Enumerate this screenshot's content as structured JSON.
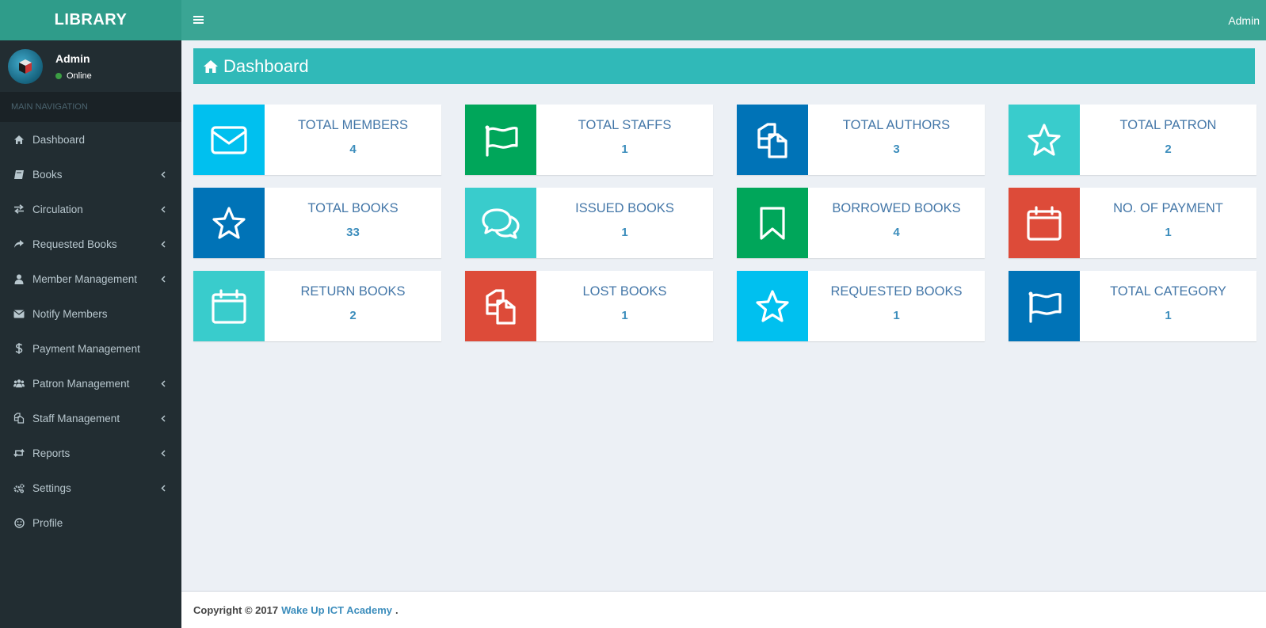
{
  "brand": "LIBRARY",
  "header": {
    "user_label": "Admin"
  },
  "user_panel": {
    "name": "Admin",
    "status": "Online"
  },
  "nav": {
    "header": "MAIN NAVIGATION",
    "items": [
      {
        "label": "Dashboard",
        "icon": "home-icon",
        "has_children": false
      },
      {
        "label": "Books",
        "icon": "book-icon",
        "has_children": true
      },
      {
        "label": "Circulation",
        "icon": "exchange-icon",
        "has_children": true
      },
      {
        "label": "Requested Books",
        "icon": "share-icon",
        "has_children": true
      },
      {
        "label": "Member Management",
        "icon": "user-icon",
        "has_children": true
      },
      {
        "label": "Notify Members",
        "icon": "envelope-icon",
        "has_children": false
      },
      {
        "label": "Payment Management",
        "icon": "dollar-icon",
        "has_children": false
      },
      {
        "label": "Patron Management",
        "icon": "users-icon",
        "has_children": true
      },
      {
        "label": "Staff Management",
        "icon": "copy-icon",
        "has_children": true
      },
      {
        "label": "Reports",
        "icon": "retweet-icon",
        "has_children": true
      },
      {
        "label": "Settings",
        "icon": "gears-icon",
        "has_children": true
      },
      {
        "label": "Profile",
        "icon": "smile-icon",
        "has_children": false
      }
    ]
  },
  "page": {
    "title": "Dashboard"
  },
  "cards": [
    {
      "title": "TOTAL MEMBERS",
      "value": "4",
      "color": "#00c0ef",
      "icon": "envelope-icon"
    },
    {
      "title": "TOTAL STAFFS",
      "value": "1",
      "color": "#00a65a",
      "icon": "flag-icon"
    },
    {
      "title": "TOTAL AUTHORS",
      "value": "3",
      "color": "#0073b7",
      "icon": "copy-icon"
    },
    {
      "title": "TOTAL PATRON",
      "value": "2",
      "color": "#39cccc",
      "icon": "star-icon"
    },
    {
      "title": "TOTAL BOOKS",
      "value": "33",
      "color": "#0073b7",
      "icon": "star-icon"
    },
    {
      "title": "ISSUED BOOKS",
      "value": "1",
      "color": "#39cccc",
      "icon": "comments-icon"
    },
    {
      "title": "BORROWED BOOKS",
      "value": "4",
      "color": "#00a65a",
      "icon": "bookmark-icon"
    },
    {
      "title": "NO. OF PAYMENT",
      "value": "1",
      "color": "#dd4b39",
      "icon": "calendar-icon"
    },
    {
      "title": "RETURN BOOKS",
      "value": "2",
      "color": "#39cccc",
      "icon": "calendar-icon"
    },
    {
      "title": "LOST BOOKS",
      "value": "1",
      "color": "#dd4b39",
      "icon": "copy-icon"
    },
    {
      "title": "REQUESTED BOOKS",
      "value": "1",
      "color": "#00c0ef",
      "icon": "star-icon"
    },
    {
      "title": "TOTAL CATEGORY",
      "value": "1",
      "color": "#0073b7",
      "icon": "flag-icon"
    }
  ],
  "footer": {
    "prefix": "Copyright © 2017",
    "link": "Wake Up ICT Academy",
    "suffix": "."
  }
}
